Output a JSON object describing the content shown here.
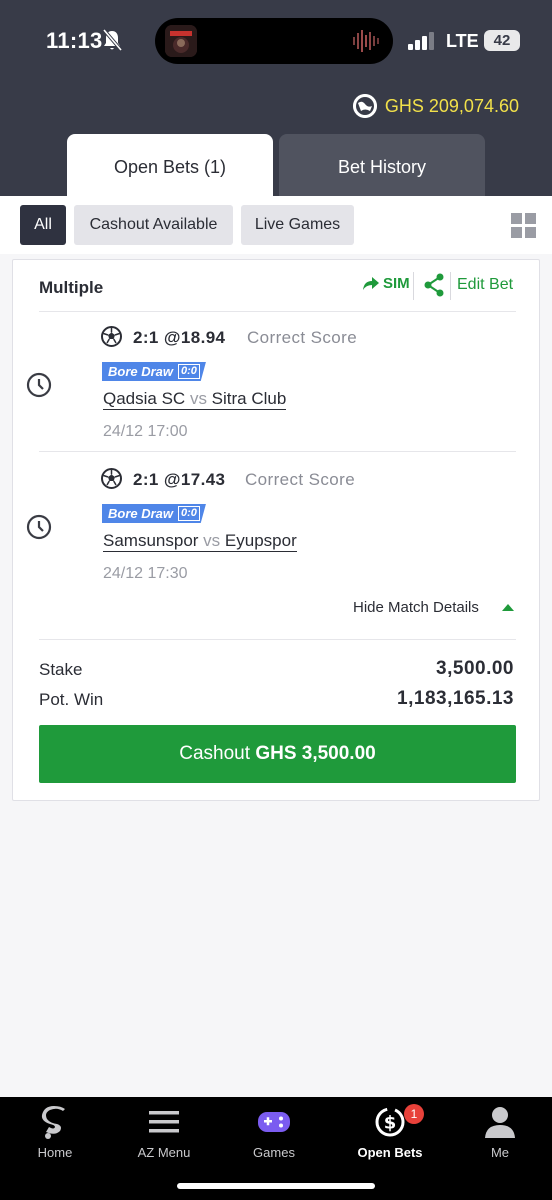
{
  "status_bar": {
    "time": "11:13",
    "network": "LTE",
    "battery": "42"
  },
  "header": {
    "balance": "GHS 209,074.60",
    "tabs": [
      {
        "label": "Open Bets (1)",
        "active": true
      },
      {
        "label": "Bet History",
        "active": false
      }
    ]
  },
  "filters": {
    "items": [
      {
        "label": "All",
        "active": true
      },
      {
        "label": "Cashout Available",
        "active": false
      },
      {
        "label": "Live Games",
        "active": false
      }
    ]
  },
  "bet": {
    "type": "Multiple",
    "sim_label": "SIM",
    "edit_label": "Edit Bet",
    "legs": [
      {
        "pick": "2:1 @18.94",
        "market": "Correct Score",
        "tag": "Bore Draw",
        "tag_score": "0:0",
        "home": "Qadsia SC",
        "vs": "vs",
        "away": "Sitra Club",
        "kickoff": "24/12 17:00"
      },
      {
        "pick": "2:1 @17.43",
        "market": "Correct Score",
        "tag": "Bore Draw",
        "tag_score": "0:0",
        "home": "Samsunspor",
        "vs": "vs",
        "away": "Eyupspor",
        "kickoff": "24/12 17:30"
      }
    ],
    "hide_details_label": "Hide Match Details",
    "stake_label": "Stake",
    "stake": "3,500.00",
    "pot_win_label": "Pot. Win",
    "pot_win": "1,183,165.13",
    "cashout_label": "Cashout",
    "cashout_amount": "GHS 3,500.00"
  },
  "nav": {
    "items": [
      {
        "label": "Home",
        "icon": "sportybet-logo-icon"
      },
      {
        "label": "AZ Menu",
        "icon": "menu-icon"
      },
      {
        "label": "Games",
        "icon": "gamepad-icon"
      },
      {
        "label": "Open Bets",
        "icon": "open-bets-icon",
        "badge": "1",
        "active": true
      },
      {
        "label": "Me",
        "icon": "user-icon"
      }
    ]
  },
  "colors": {
    "header_bg": "#383b48",
    "accent_green": "#1f9a3b",
    "balance_yellow": "#f1e04a",
    "badge_blue": "#4f86e8"
  }
}
